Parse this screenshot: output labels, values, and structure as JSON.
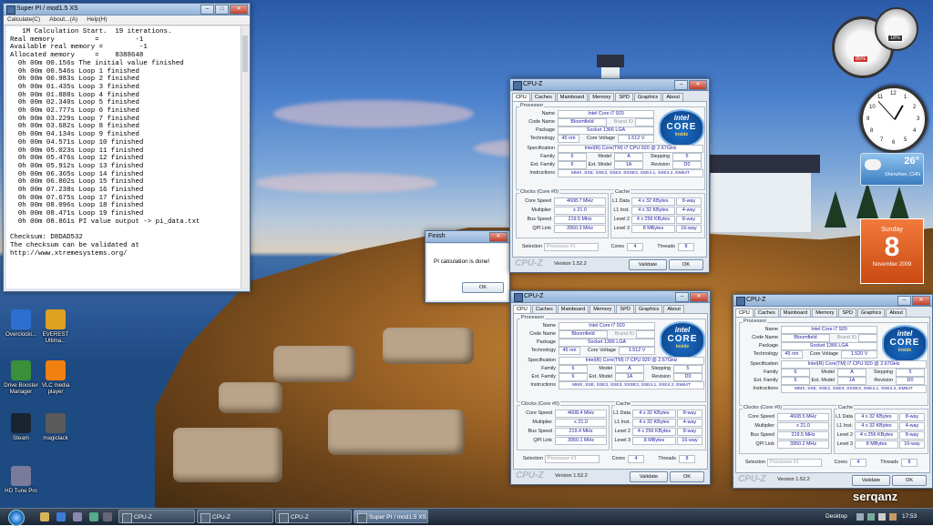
{
  "superpi": {
    "title": "Super PI / mod1.5 XS",
    "menu": [
      "Calculate(C)",
      "About...(A)",
      "Help(H)"
    ],
    "console": "   1M Calculation Start.  19 iterations.\nReal memory          =         -1\nAvailable real memory =         -1\nAllocated memory     =    8388648\n  0h 00m 00.156s The initial value finished\n  0h 00m 00.546s Loop 1 finished\n  0h 00m 00.983s Loop 2 finished\n  0h 00m 01.435s Loop 3 finished\n  0h 00m 01.888s Loop 4 finished\n  0h 00m 02.340s Loop 5 finished\n  0h 00m 02.777s Loop 6 finished\n  0h 00m 03.229s Loop 7 finished\n  0h 00m 03.682s Loop 8 finished\n  0h 00m 04.134s Loop 9 finished\n  0h 00m 04.571s Loop 10 finished\n  0h 00m 05.023s Loop 11 finished\n  0h 00m 05.476s Loop 12 finished\n  0h 00m 05.912s Loop 13 finished\n  0h 00m 06.365s Loop 14 finished\n  0h 00m 06.802s Loop 15 finished\n  0h 00m 07.238s Loop 16 finished\n  0h 00m 07.675s Loop 17 finished\n  0h 00m 08.096s Loop 18 finished\n  0h 00m 08.471s Loop 19 finished\n  0h 00m 08.861s PI value output -> pi_data.txt\n\nChecksum: D8DAD532\nThe checksum can be validated at\nhttp://www.xtremesystems.org/"
  },
  "finish": {
    "title": "Finish",
    "message": "PI calculation is done!",
    "ok": "OK"
  },
  "cpuz_common": {
    "title": "CPU-Z",
    "tabs": [
      "CPU",
      "Caches",
      "Mainboard",
      "Memory",
      "SPD",
      "Graphics",
      "About"
    ],
    "processor_group": "Processor",
    "clocks_group": "Clocks (Core #0)",
    "cache_group": "Cache",
    "labels": {
      "name": "Name",
      "code_name": "Code Name",
      "brand_id": "Brand ID",
      "package": "Package",
      "technology": "Technology",
      "core_voltage": "Core Voltage",
      "specification": "Specification",
      "family": "Family",
      "model": "Model",
      "stepping": "Stepping",
      "ext_family": "Ext. Family",
      "ext_model": "Ext. Model",
      "revision": "Revision",
      "instructions": "Instructions",
      "core_speed": "Core Speed",
      "multiplier": "Multiplier",
      "bus_speed": "Bus Speed",
      "qpi_link": "QPI Link",
      "l1_data": "L1 Data",
      "l1_inst": "L1 Inst.",
      "level2": "Level 2",
      "level3": "Level 3",
      "selection": "Selection",
      "cores": "Cores",
      "threads": "Threads"
    },
    "logo": "CPU-Z",
    "version": "Version 1.52.2",
    "validate": "Validate",
    "ok": "OK",
    "intel": {
      "brand": "intel",
      "line": "CORE",
      "badge": "i7",
      "inside": "inside"
    },
    "name": "Intel Core i7 920",
    "code_name": "Bloomfield",
    "package": "Socket 1366 LGA",
    "technology": "45 nm",
    "specification": "Intel(R) Core(TM) i7 CPU         920  @ 2.67GHz",
    "family": "6",
    "model": "A",
    "stepping": "5",
    "ext_family": "6",
    "ext_model": "1A",
    "revision": "D0",
    "instructions": "MMX, SSE, SSE2, SSE3, SSSE3, SSE4.1, SSE4.2, EM64T",
    "multiplier": "x 21.0",
    "l1_data": "4 x 32 KBytes",
    "l1_data_way": "8-way",
    "l1_inst": "4 x 32 KBytes",
    "l1_inst_way": "4-way",
    "level2": "4 x 256 KBytes",
    "level2_way": "8-way",
    "level3": "8 MBytes",
    "level3_way": "16-way",
    "selection": "Processor #1",
    "cores": "4",
    "threads": "8"
  },
  "cpuz_windows": [
    {
      "voltage": "1.512 V",
      "core_speed": "4608.7 MHz",
      "bus_speed": "219.5 MHz",
      "qpi_link": "3950.3 MHz"
    },
    {
      "voltage": "1.512 V",
      "core_speed": "4608.4 MHz",
      "bus_speed": "219.4 MHz",
      "qpi_link": "3950.1 MHz"
    },
    {
      "voltage": "1.520 V",
      "core_speed": "4608.5 MHz",
      "bus_speed": "219.5 MHz",
      "qpi_link": "3950.2 MHz"
    }
  ],
  "gadgets": {
    "meter_left": "85%",
    "meter_right": "18%",
    "weather_temp": "26°",
    "weather_city": "Shenzhen, CHN",
    "calendar_day": "Sunday",
    "calendar_date": "8",
    "calendar_month": "November 2009",
    "clock_numbers": [
      "12",
      "1",
      "2",
      "3",
      "4",
      "5",
      "6",
      "7",
      "8",
      "9",
      "10",
      "11"
    ]
  },
  "desktop_icons": [
    {
      "label": "Overclocki...",
      "color": "#2d6fd1"
    },
    {
      "label": "EVEREST Ultima...",
      "color": "#e0a020"
    },
    {
      "label": "Drive Booster Manager",
      "color": "#3a8f3a"
    },
    {
      "label": "VLC media player",
      "color": "#f08010"
    },
    {
      "label": "Steam",
      "color": "#1a2430"
    },
    {
      "label": "magiclack",
      "color": "#5a5a5a"
    },
    {
      "label": "HD Tune Pro",
      "color": "#7a7a9a"
    }
  ],
  "taskbar": {
    "items": [
      "CPU-Z",
      "CPU-Z",
      "CPU-Z",
      "Super PI / mod1.5 XS"
    ],
    "desktop_label": "Desktop",
    "time": "17:53"
  },
  "watermark": "serqanz"
}
